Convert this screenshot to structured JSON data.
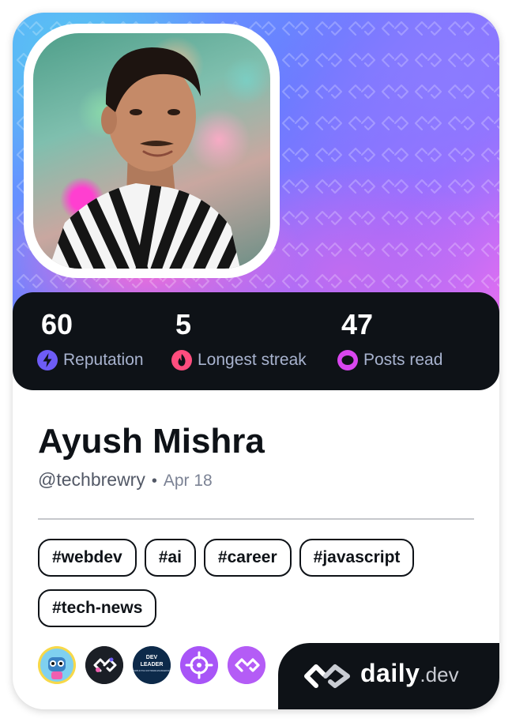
{
  "profile": {
    "name": "Ayush Mishra",
    "handle": "@techbrewry",
    "separator": "•",
    "date": "Apr 18"
  },
  "stats": [
    {
      "value": "60",
      "label": "Reputation",
      "icon": "lightning-icon",
      "color": "#6e5cf6"
    },
    {
      "value": "5",
      "label": "Longest streak",
      "icon": "flame-icon",
      "color": "#ff4d7e"
    },
    {
      "value": "47",
      "label": "Posts read",
      "icon": "eye-ring-icon",
      "color": "#d946ef"
    }
  ],
  "tags": [
    "#webdev",
    "#ai",
    "#career",
    "#javascript",
    "#tech-news"
  ],
  "badges": [
    {
      "name": "robot-squad-badge"
    },
    {
      "name": "daily-dev-squad-badge"
    },
    {
      "name": "dev-leader-badge",
      "text_line1": "DEV",
      "text_line2": "LEADER",
      "text_line3": "SIMPLIFYING SOFTWARE ENGINEERING"
    },
    {
      "name": "crosshair-squad-badge"
    },
    {
      "name": "daily-dev-purple-badge"
    }
  ],
  "brand": {
    "daily": "daily",
    "dev": ".dev"
  },
  "colors": {
    "dark": "#0e1217",
    "muted": "#a8b3cf",
    "purple": "#a855f7"
  }
}
